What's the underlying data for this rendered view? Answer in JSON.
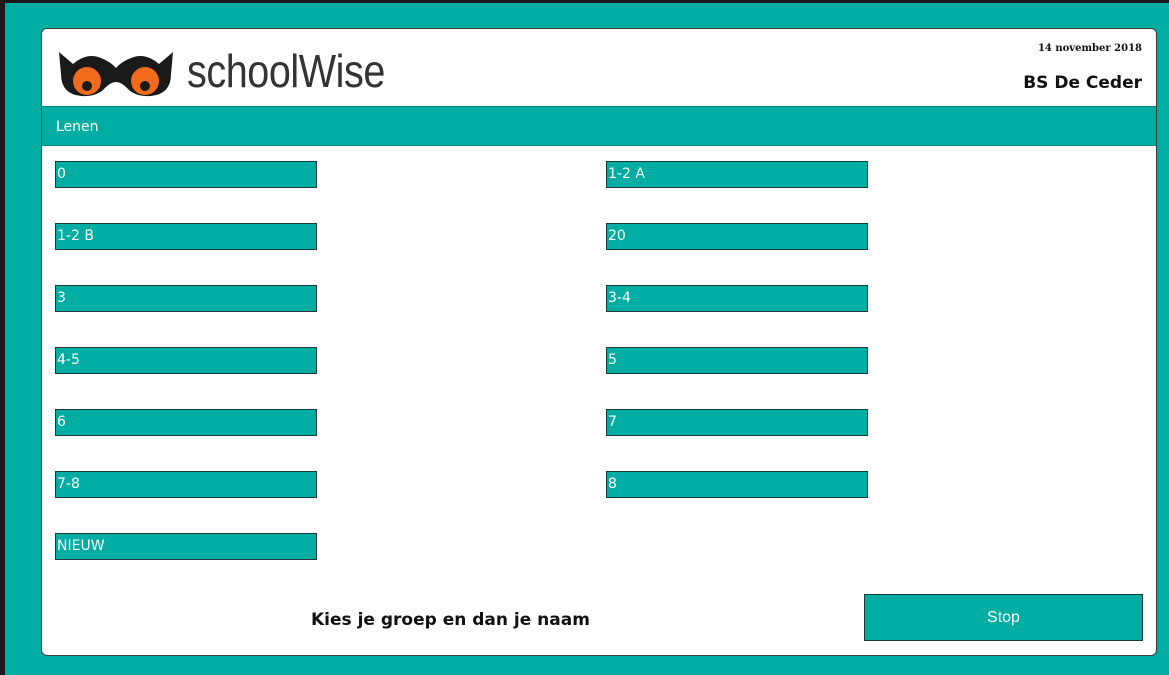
{
  "app": {
    "name": "schoolWise",
    "date": "14 november 2018",
    "school": "BS De Ceder"
  },
  "nav": {
    "label": "Lenen"
  },
  "groups": {
    "left": [
      "0",
      "1-2 B",
      "3",
      "4-5",
      "6",
      "7-8",
      "NIEUW"
    ],
    "right": [
      "1-2 A",
      "20",
      "3-4",
      "5",
      "7",
      "8"
    ]
  },
  "footer": {
    "prompt": "Kies je groep en dan je naam",
    "stop_label": "Stop"
  },
  "colors": {
    "accent": "#00ADA3",
    "owl_body": "#1a1a1a",
    "owl_eye": "#F26A1B"
  }
}
